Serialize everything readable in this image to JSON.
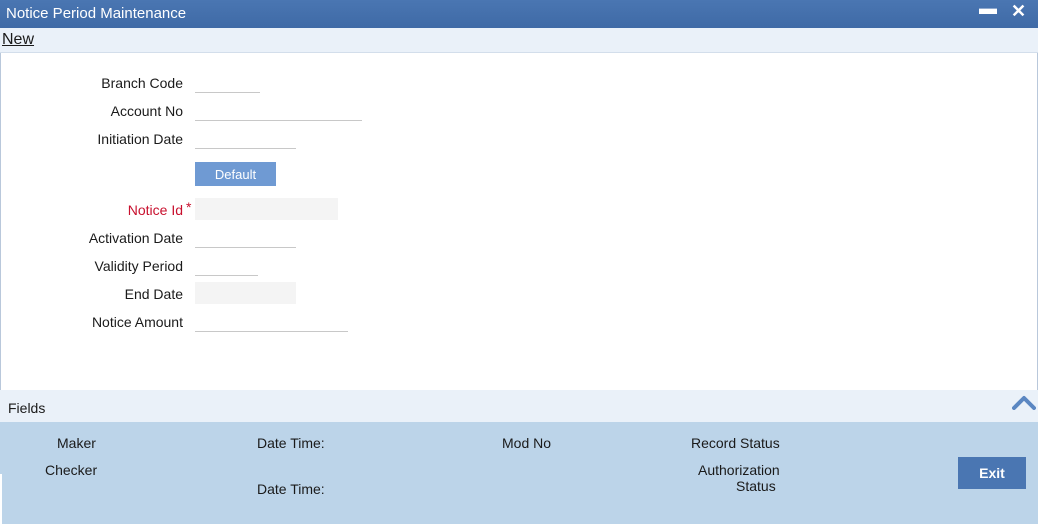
{
  "window": {
    "title": "Notice Period Maintenance",
    "minimize_symbol": "▬",
    "close_symbol": "✕"
  },
  "toolbar": {
    "new_label": "New"
  },
  "form": {
    "branch_code_label": "Branch Code",
    "account_no_label": "Account No",
    "initiation_date_label": "Initiation Date",
    "default_button_label": "Default",
    "notice_id_label": "Notice Id",
    "required_marker": "*",
    "activation_date_label": "Activation Date",
    "validity_period_label": "Validity Period",
    "end_date_label": "End Date",
    "notice_amount_label": "Notice Amount",
    "values": {
      "branch_code": "",
      "account_no": "",
      "initiation_date": "",
      "notice_id": "",
      "activation_date": "",
      "validity_period": "",
      "end_date": "",
      "notice_amount": ""
    }
  },
  "fields_bar": {
    "label": "Fields",
    "icon": "chevron-up-icon"
  },
  "audit": {
    "maker_label": "Maker",
    "checker_label": "Checker",
    "date_time_label_1": "Date Time:",
    "date_time_label_2": "Date Time:",
    "mod_no_label": "Mod No",
    "record_status_label": "Record Status",
    "authorization_label": "Authorization",
    "status_label": "Status",
    "exit_label": "Exit"
  },
  "colors": {
    "titlebar": "#4a76b2",
    "button": "#6f9ad3",
    "audit_panel": "#bcd4e9",
    "required": "#c8102e"
  }
}
